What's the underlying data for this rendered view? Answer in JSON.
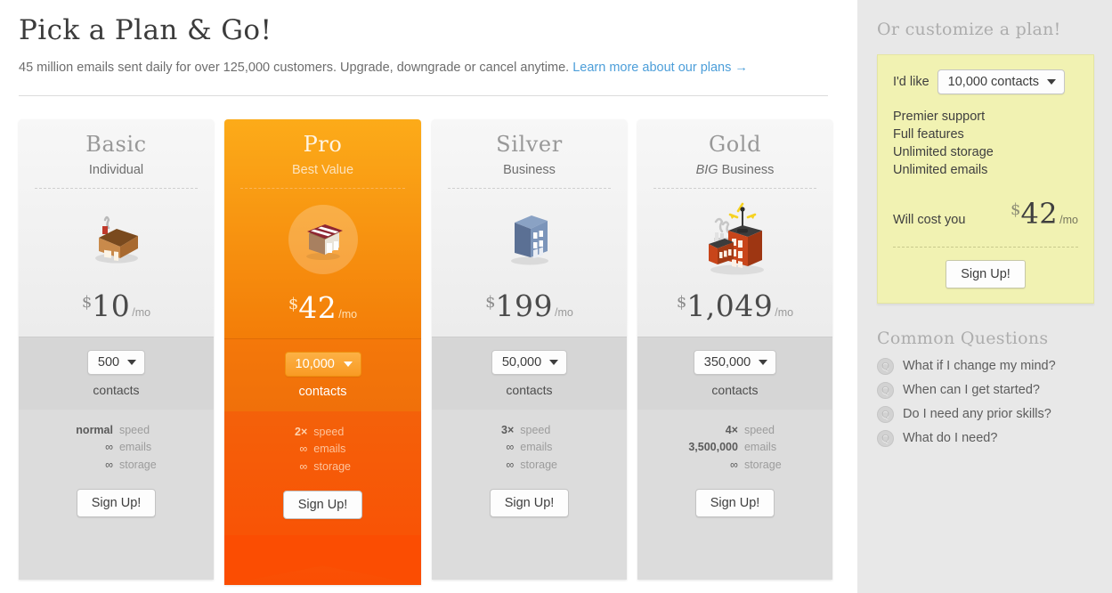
{
  "header": {
    "title": "Pick a Plan & Go!",
    "subtitle": "45 million emails sent daily for over 125,000 customers. Upgrade, downgrade or cancel anytime.",
    "link": "Learn more about our plans →"
  },
  "plans": [
    {
      "name": "Basic",
      "tagline": "Individual",
      "tagline_em": "",
      "icon": "house-icon",
      "currency": "$",
      "price": "10",
      "per": "/mo",
      "contacts_value": "500",
      "contacts_label": "contacts",
      "specs": [
        {
          "value": "normal",
          "key": "speed"
        },
        {
          "value": "∞",
          "key": "emails"
        },
        {
          "value": "∞",
          "key": "storage"
        }
      ],
      "signup": "Sign Up!",
      "featured": false
    },
    {
      "name": "Pro",
      "tagline": "Best Value",
      "tagline_em": "",
      "icon": "shop-icon",
      "currency": "$",
      "price": "42",
      "per": "/mo",
      "contacts_value": "10,000",
      "contacts_label": "contacts",
      "specs": [
        {
          "value": "2×",
          "key": "speed"
        },
        {
          "value": "∞",
          "key": "emails"
        },
        {
          "value": "∞",
          "key": "storage"
        }
      ],
      "signup": "Sign Up!",
      "featured": true
    },
    {
      "name": "Silver",
      "tagline": "Business",
      "tagline_em": "",
      "icon": "office-building-icon",
      "currency": "$",
      "price": "199",
      "per": "/mo",
      "contacts_value": "50,000",
      "contacts_label": "contacts",
      "specs": [
        {
          "value": "3×",
          "key": "speed"
        },
        {
          "value": "∞",
          "key": "emails"
        },
        {
          "value": "∞",
          "key": "storage"
        }
      ],
      "signup": "Sign Up!",
      "featured": false
    },
    {
      "name": "Gold",
      "tagline": " Business",
      "tagline_em": "BIG",
      "icon": "factory-icon",
      "currency": "$",
      "price": "1,049",
      "per": "/mo",
      "contacts_value": "350,000",
      "contacts_label": "contacts",
      "specs": [
        {
          "value": "4×",
          "key": "speed"
        },
        {
          "value": "3,500,000",
          "key": "emails"
        },
        {
          "value": "∞",
          "key": "storage"
        }
      ],
      "signup": "Sign Up!",
      "featured": false
    }
  ],
  "sidebar": {
    "customize_title": "Or customize a plan!",
    "ild_label": "I'd like",
    "ild_value": "10,000 contacts",
    "features": [
      "Premier support",
      "Full features",
      "Unlimited storage",
      "Unlimited emails"
    ],
    "cost_label": "Will cost you",
    "cost_currency": "$",
    "cost_amount": "42",
    "cost_per": "/mo",
    "signup": "Sign Up!",
    "faq_title": "Common Questions",
    "faq_badge": "Q",
    "faqs": [
      "What if I change my mind?",
      "When can I get started?",
      "Do I need any prior skills?",
      "What do I need?"
    ]
  },
  "colors": {
    "accent_orange": "#f5880d",
    "accent_orange_deep": "#fb4d02",
    "link_blue": "#4c9ed9",
    "yellow_panel": "#f1f2b2",
    "sidebar_bg": "#e8e8e8"
  }
}
